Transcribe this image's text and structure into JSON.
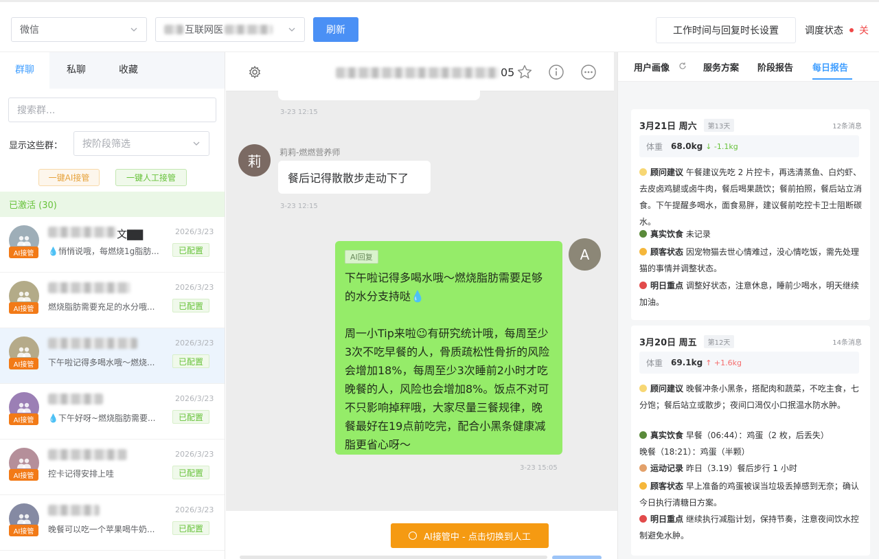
{
  "toolbar": {
    "platform_select": "微信",
    "account_select_suffix": "互联网医",
    "refresh_label": "刷新",
    "work_time_label": "工作时间与回复时长设置",
    "dispatch_label": "调度状态",
    "dispatch_value": "关"
  },
  "left": {
    "tabs": [
      "群聊",
      "私聊",
      "收藏"
    ],
    "search_placeholder": "搜索群...",
    "show_label": "显示这些群：",
    "stage_placeholder": "按阶段筛选",
    "ai_takeover_all": "一键AI接管",
    "manual_takeover_all": "一键人工接管",
    "active_header": "已激活 (30)",
    "items": [
      {
        "name_suffix": "文▇▇",
        "date": "2026/3/23",
        "preview": "💧悄悄说哦，每燃烧1g脂肪...",
        "badge": "AI接管",
        "tag": "已配置",
        "avatar_color": "#9eaeb8"
      },
      {
        "date": "2026/3/23",
        "preview": "燃烧脂肪需要充足的水分哦...",
        "badge": "AI接管",
        "tag": "已配置",
        "avatar_color": "#b3ab88"
      },
      {
        "date": "2026/3/23",
        "preview": "下午啦记得多喝水哦～燃烧...",
        "badge": "AI接管",
        "tag": "已配置",
        "avatar_color": "#b5aa89"
      },
      {
        "date": "2026/3/23",
        "preview": "💧下午好呀~燃烧脂肪需要...",
        "badge": "AI接管",
        "tag": "已配置",
        "avatar_color": "#9b7fb5"
      },
      {
        "date": "2026/3/23",
        "preview": "控卡记得安排上哇",
        "badge": "AI接管",
        "tag": "已配置",
        "avatar_color": "#b58f9a"
      },
      {
        "date": "2026/3/23",
        "preview": "晚餐可以吃一个苹果喝牛奶...",
        "badge": "AI接管",
        "tag": "已配置",
        "avatar_color": "#858aa3"
      }
    ]
  },
  "chat": {
    "title_suffix": "05",
    "ts1": "3-23 12:15",
    "sender_avatar": "莉",
    "sender_name": "莉莉-燃燃营养师",
    "msg1": "餐后记得散散步走动下了",
    "ts2": "3-23 12:15",
    "ai_tag": "AI回复",
    "msg2": "下午啦记得多喝水哦～燃烧脂肪需要足够的水分支持哒💧\n\n周一小Tip来啦😉有研究统计哦，每周至少3次不吃早餐的人，骨质疏松性骨折的风险会增加18%，每周至少3次睡前2小时才吃晚餐的人，风险也会增加8%。饭点不对可不只影响掉秤哦，大家尽量三餐规律，晚餐最好在19点前吃完，配合小黑条健康减脂更省心呀～",
    "my_avatar": "A",
    "ts3": "3-23 15:05",
    "takeover_label": "AI接管中 - 点击切换到人工"
  },
  "right": {
    "tabs": [
      "用户画像",
      "服务方案",
      "阶段报告",
      "每日报告"
    ],
    "cards": [
      {
        "date": "3月21日 周六",
        "day": "第13天",
        "msgs": "12条消息",
        "weight_label": "体重",
        "weight": "68.0kg",
        "delta": "↓ -1.1kg",
        "advice_title": "顾问建议",
        "advice": "午餐建议先吃 2 片控卡，再选清蒸鱼、白灼虾、去皮卤鸡腿或卤牛肉，餐后喝果蔬饮；餐前拍照，餐后站立消食。下午提醒多喝水，面食易胖，建议餐前吃控卡卫士阻断碳水。",
        "diet_title": "真实饮食",
        "diet": "未记录",
        "status_title": "顾客状态",
        "status": "因宠物猫去世心情难过，没心情吃饭，需先处理猫的事情并调整状态。",
        "focus_title": "明日重点",
        "focus": "调整好状态，注意休息，睡前少喝水，明天继续加油。"
      },
      {
        "date": "3月20日 周五",
        "day": "第12天",
        "msgs": "14条消息",
        "weight_label": "体重",
        "weight": "69.1kg",
        "delta": "↑ +1.6kg",
        "advice_title": "顾问建议",
        "advice": "晚餐冲条小黑条，搭配肉和蔬菜，不吃主食，七分饱；餐后站立或散步；夜间口渴仅小口抿温水防水肿。",
        "diet_title": "真实饮食",
        "diet_l1": "早餐（06:44）：鸡蛋（2 枚，后丢失）",
        "diet_l2": "晚餐（18:21）：鸡蛋（半颗）",
        "sport_title": "运动记录",
        "sport": "昨日（3.19）餐后步行 1 小时",
        "status_title": "顾客状态",
        "status": "早上准备的鸡蛋被误当垃圾丢掉感到无奈；确认今日执行清糖日方案。",
        "focus_title": "明日重点",
        "focus": "继续执行减脂计划，保持节奏，注意夜间饮水控制避免水肿。"
      }
    ]
  },
  "colors": {
    "primary": "#409eff",
    "ai_orange": "#f59a12",
    "bubble_green": "#95ec69",
    "success": "#67c23a",
    "danger": "#f56c6c"
  }
}
